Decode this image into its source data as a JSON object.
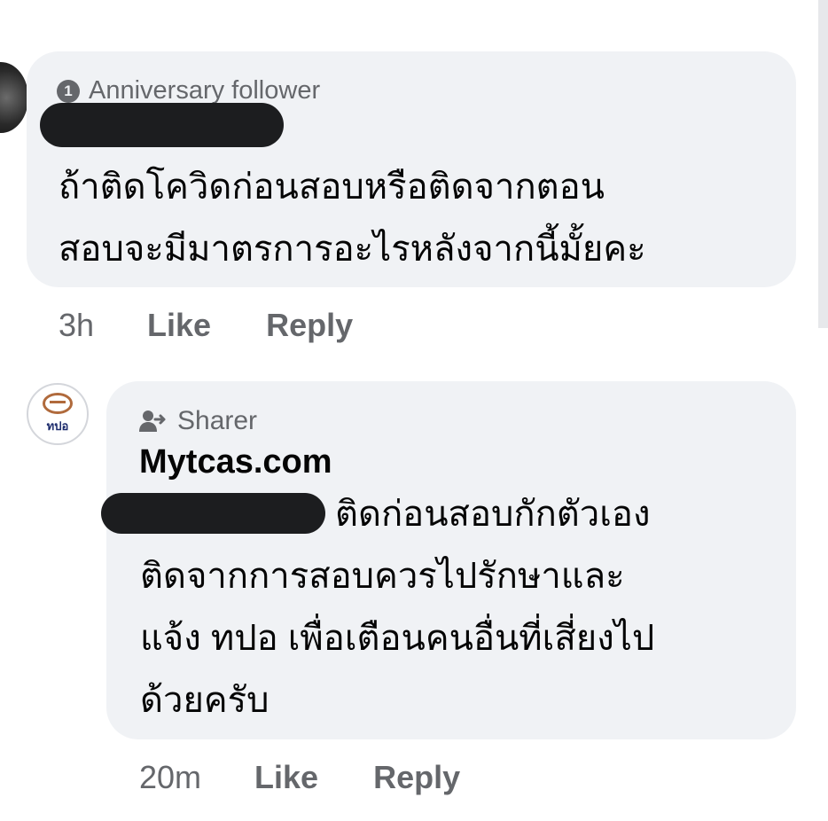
{
  "comment1": {
    "badge": "Anniversary follower",
    "badge_number": "1",
    "text_lines": [
      "ถ้าติดโควิดก่อนสอบหรือติดจากตอน",
      "สอบจะมีมาตรการอะไรหลังจากนี้มั้ยคะ"
    ],
    "time": "3h",
    "like": "Like",
    "reply": "Reply"
  },
  "comment2": {
    "badge": "Sharer",
    "author": "Mytcas.com",
    "avatar_text": "ทปอ",
    "first_line": "ติดก่อนสอบกักตัวเอง",
    "text_lines": [
      "ติดจากการสอบควรไปรักษาและ",
      "แจ้ง ทปอ เพื่อเตือนคนอื่นที่เสี่ยงไป",
      "ด้วยครับ"
    ],
    "time": "20m",
    "like": "Like",
    "reply": "Reply"
  },
  "colors": {
    "bubble": "#f0f2f5",
    "meta_text": "#65676b",
    "body_text": "#050505",
    "redaction": "#1c1d1f"
  },
  "icons": {
    "badge_icon": "anniversary-badge-icon",
    "sharer_icon": "sharer-person-icon"
  }
}
